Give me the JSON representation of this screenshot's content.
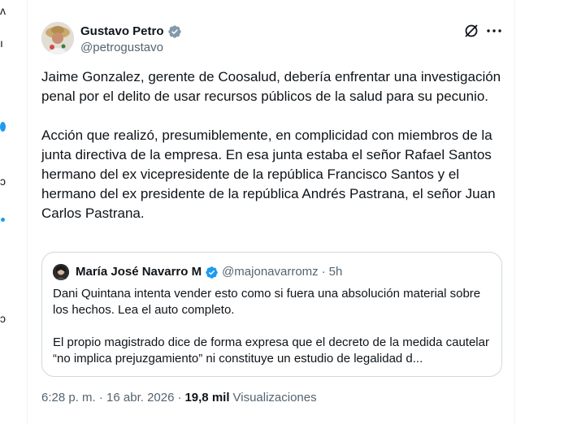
{
  "author": {
    "name": "Gustavo Petro",
    "handle": "@petrogustavo",
    "verified_badge": "verified-badge-icon",
    "badge_color": "#829aab"
  },
  "actions": {
    "grok_icon": "grok-icon",
    "more_icon": "more-options-icon"
  },
  "tweet": {
    "paragraphs": [
      "Jaime Gonzalez, gerente de Coosalud, debería enfrentar una investigación penal por el delito de usar recursos públicos de la salud para su pecunio.",
      "Acción que realizó, presumiblemente, en complicidad con miembros de la junta directiva de la empresa. En esa junta estaba el señor Rafael Santos hermano del ex vicepresidente de la república Francisco Santos y el hermano del ex presidente de la república Andrés Pastrana, el señor Juan Carlos Pastrana."
    ]
  },
  "quote": {
    "name": "María José Navarro M",
    "handle": "@majonavarromz",
    "separator": "·",
    "time": "5h",
    "verified_badge": "verified-badge-icon",
    "badge_color": "#1d9bf0",
    "paragraphs": [
      "Dani Quintana intenta vender esto como si fuera una absolución material sobre los hechos. Lea el auto completo.",
      "El propio magistrado dice de forma expresa que el decreto de la medida cautelar “no implica prejuzgamiento” ni constituye un estudio de legalidad d..."
    ]
  },
  "meta": {
    "timestamp": "6:28 p. m. · 16 abr. 2026",
    "separator": "·",
    "views_count": "19,8 mil",
    "views_label": "Visualizaciones"
  },
  "colors": {
    "text": "#0f1419",
    "secondary": "#536471",
    "border": "#cfd9de",
    "accent": "#1d9bf0"
  }
}
